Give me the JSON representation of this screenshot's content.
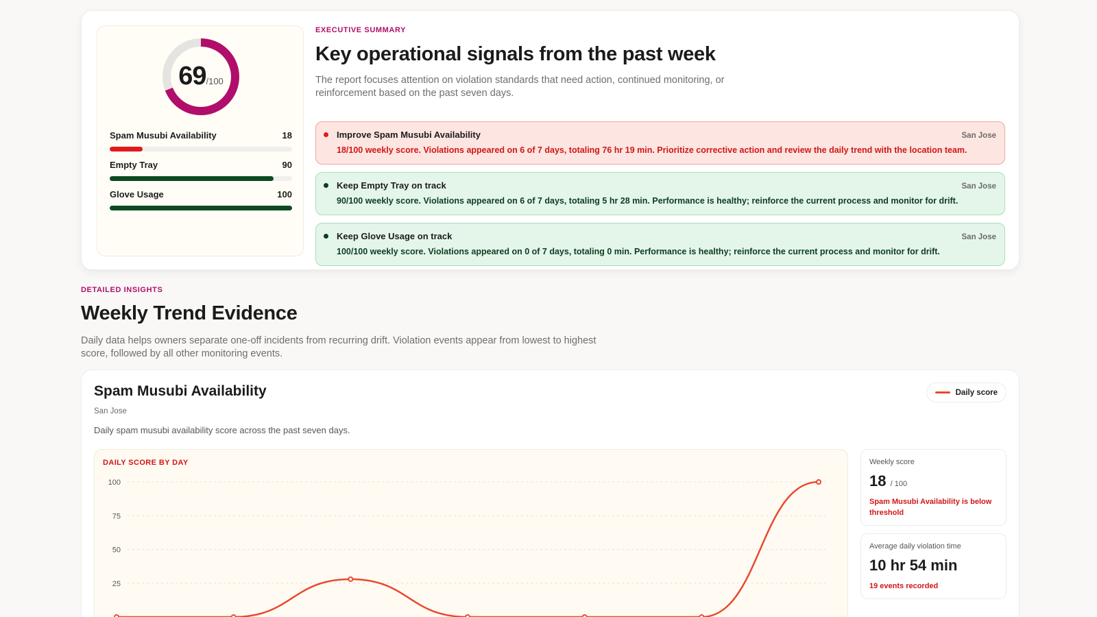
{
  "colors": {
    "brand": "#b00e6a",
    "bad": "#e01b1b",
    "good": "#0d4a22",
    "line": "#e9482f"
  },
  "executive": {
    "eyebrow": "EXECUTIVE SUMMARY",
    "title": "Key operational signals from the past week",
    "description": "The report focuses attention on violation standards that need action, continued monitoring, or reinforcement based on the past seven days.",
    "overall_score": "69",
    "overall_score_max": "/100",
    "overall_score_value": 69,
    "metrics": [
      {
        "label": "Spam Musubi Availability",
        "value": "18",
        "pct": 18,
        "status": "bad"
      },
      {
        "label": "Empty Tray",
        "value": "90",
        "pct": 90,
        "status": "good"
      },
      {
        "label": "Glove Usage",
        "value": "100",
        "pct": 100,
        "status": "good"
      }
    ],
    "alerts": [
      {
        "title": "Improve Spam Musubi Availability",
        "location": "San Jose",
        "body": "18/100 weekly score. Violations appeared on 6 of 7 days, totaling 76 hr 19 min. Prioritize corrective action and review the daily trend with the location team.",
        "status": "red"
      },
      {
        "title": "Keep Empty Tray on track",
        "location": "San Jose",
        "body": "90/100 weekly score. Violations appeared on 6 of 7 days, totaling 5 hr 28 min. Performance is healthy; reinforce the current process and monitor for drift.",
        "status": "green"
      },
      {
        "title": "Keep Glove Usage on track",
        "location": "San Jose",
        "body": "100/100 weekly score. Violations appeared on 0 of 7 days, totaling 0 min. Performance is healthy; reinforce the current process and monitor for drift.",
        "status": "green"
      }
    ]
  },
  "insights": {
    "eyebrow": "DETAILED INSIGHTS",
    "title": "Weekly Trend Evidence",
    "description": "Daily data helps owners separate one-off incidents from recurring drift. Violation events appear from lowest to highest score, followed by all other monitoring events."
  },
  "trend_card": {
    "title": "Spam Musubi Availability",
    "location": "San Jose",
    "description": "Daily spam musubi availability score across the past seven days.",
    "legend_label": "Daily score",
    "chart_label": "DAILY SCORE BY DAY",
    "weekly_score_label": "Weekly score",
    "weekly_score_value": "18",
    "weekly_score_unit": "/ 100",
    "weekly_score_note": "Spam Musubi Availability is below threshold",
    "avg_violation_label": "Average daily violation time",
    "avg_violation_value": "10 hr 54 min",
    "avg_violation_note": "19 events recorded"
  },
  "chart_data": {
    "type": "line",
    "title": "DAILY SCORE BY DAY",
    "xlabel": "",
    "ylabel": "",
    "ylim": [
      0,
      100
    ],
    "y_ticks": [
      100,
      75,
      50,
      25
    ],
    "grid": true,
    "legend": "top-right",
    "series": [
      {
        "name": "Daily score",
        "values": [
          0,
          0,
          28,
          0,
          0,
          0,
          100
        ]
      }
    ]
  }
}
